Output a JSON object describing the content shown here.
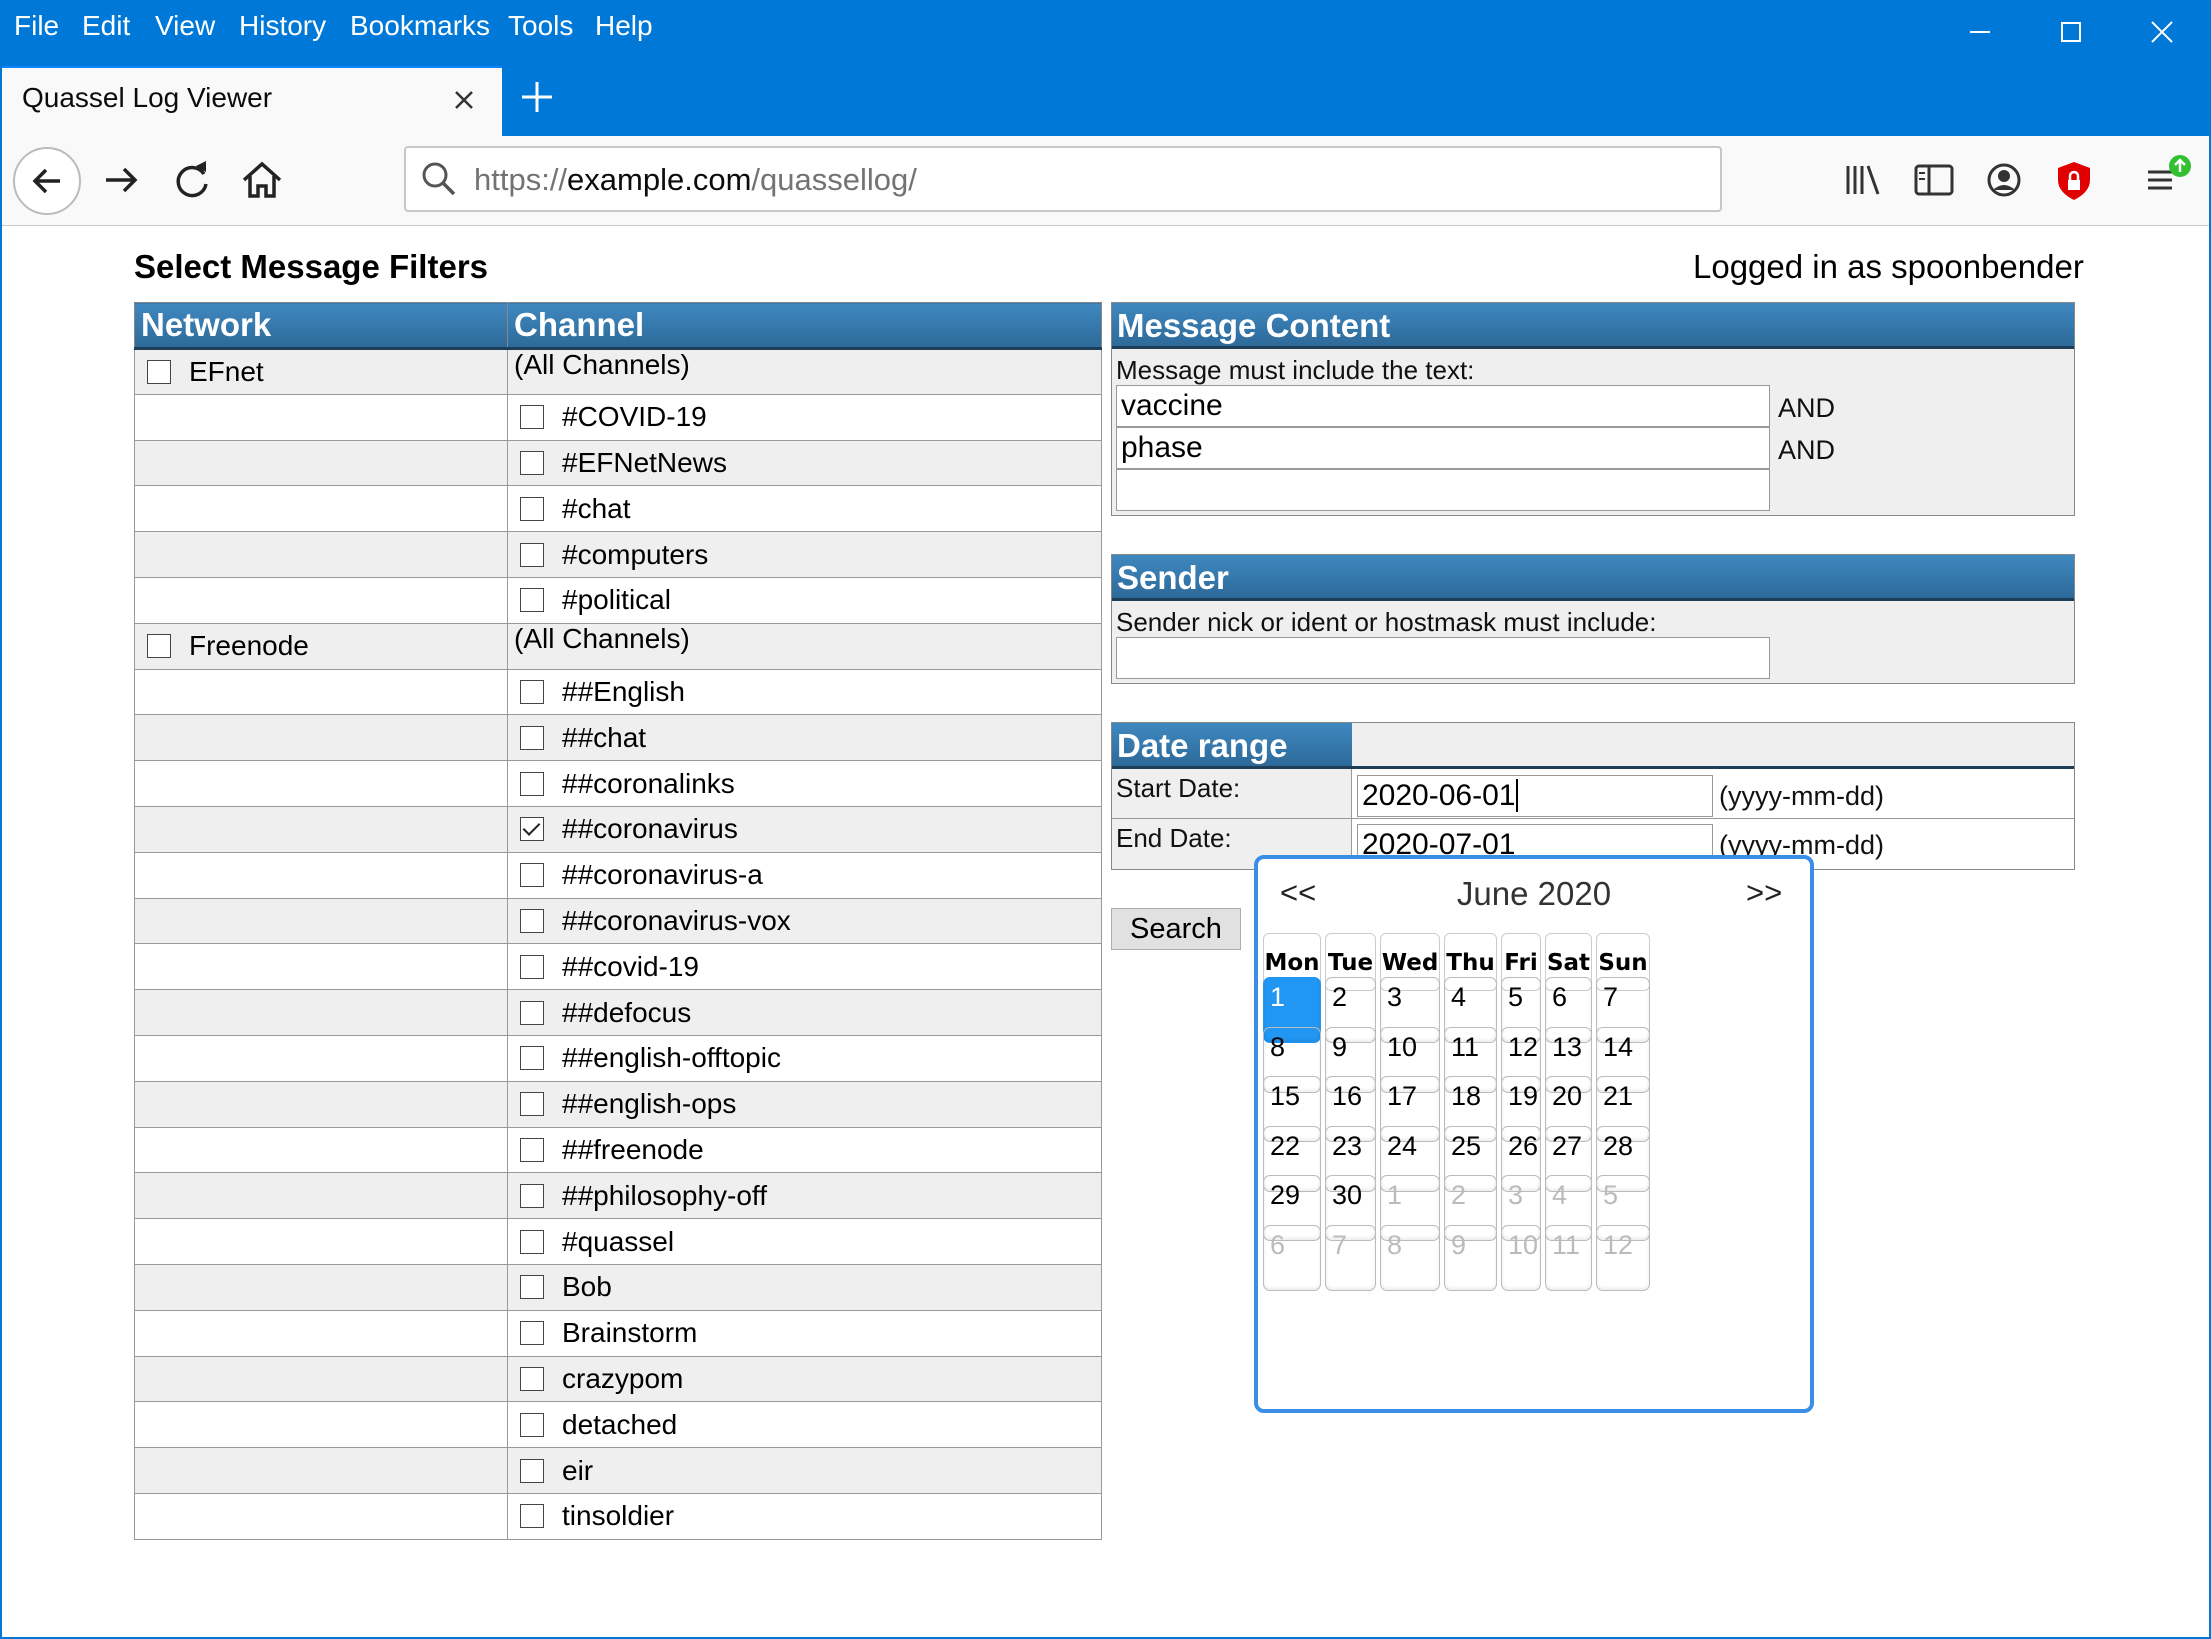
{
  "browser": {
    "menu": [
      "File",
      "Edit",
      "View",
      "History",
      "Bookmarks",
      "Tools",
      "Help"
    ],
    "tab_title": "Quassel Log Viewer",
    "url_scheme": "https://",
    "url_host": "example.com",
    "url_path": "/quassellog/",
    "accent_color": "#0078d7"
  },
  "page": {
    "title": "Select Message Filters",
    "logged_in": "Logged in as spoonbender"
  },
  "filters": {
    "network_header": "Network",
    "channel_header": "Channel",
    "all_channels": "(All Channels)",
    "networks": [
      {
        "name": "EFnet",
        "checked": false,
        "channels": [
          {
            "name": "#COVID-19",
            "checked": false
          },
          {
            "name": "#EFNetNews",
            "checked": false
          },
          {
            "name": "#chat",
            "checked": false
          },
          {
            "name": "#computers",
            "checked": false
          },
          {
            "name": "#political",
            "checked": false
          }
        ]
      },
      {
        "name": "Freenode",
        "checked": false,
        "channels": [
          {
            "name": "##English",
            "checked": false
          },
          {
            "name": "##chat",
            "checked": false
          },
          {
            "name": "##coronalinks",
            "checked": false
          },
          {
            "name": "##coronavirus",
            "checked": true
          },
          {
            "name": "##coronavirus-a",
            "checked": false
          },
          {
            "name": "##coronavirus-vox",
            "checked": false
          },
          {
            "name": "##covid-19",
            "checked": false
          },
          {
            "name": "##defocus",
            "checked": false
          },
          {
            "name": "##english-offtopic",
            "checked": false
          },
          {
            "name": "##english-ops",
            "checked": false
          },
          {
            "name": "##freenode",
            "checked": false
          },
          {
            "name": "##philosophy-off",
            "checked": false
          },
          {
            "name": "#quassel",
            "checked": false
          },
          {
            "name": "Bob",
            "checked": false
          },
          {
            "name": "Brainstorm",
            "checked": false
          },
          {
            "name": "crazypom",
            "checked": false
          },
          {
            "name": "detached",
            "checked": false
          },
          {
            "name": "eir",
            "checked": false
          },
          {
            "name": "tinsoldier",
            "checked": false
          }
        ]
      }
    ]
  },
  "message_content": {
    "header": "Message Content",
    "label": "Message must include the text:",
    "terms": [
      "vaccine",
      "phase",
      ""
    ],
    "and_label": "AND"
  },
  "sender": {
    "header": "Sender",
    "label": "Sender nick or ident or hostmask must include:",
    "value": ""
  },
  "date_range": {
    "header": "Date range",
    "start_label": "Start Date:",
    "start_value": "2020-06-01",
    "end_label": "End Date:",
    "end_value": "2020-07-01",
    "format_hint": "(yyyy-mm-dd)"
  },
  "search_button": "Search",
  "calendar": {
    "prev": "<<",
    "next": ">>",
    "month_title": "June 2020",
    "day_names": [
      "Mon",
      "Tue",
      "Wed",
      "Thu",
      "Fri",
      "Sat",
      "Sun"
    ],
    "weeks": [
      [
        1,
        2,
        3,
        4,
        5,
        6,
        7
      ],
      [
        8,
        9,
        10,
        11,
        12,
        13,
        14
      ],
      [
        15,
        16,
        17,
        18,
        19,
        20,
        21
      ],
      [
        22,
        23,
        24,
        25,
        26,
        27,
        28
      ],
      [
        29,
        30,
        1,
        2,
        3,
        4,
        5
      ],
      [
        6,
        7,
        8,
        9,
        10,
        11,
        12
      ]
    ],
    "selected_day": 1,
    "selected_color": "#2196f3"
  }
}
